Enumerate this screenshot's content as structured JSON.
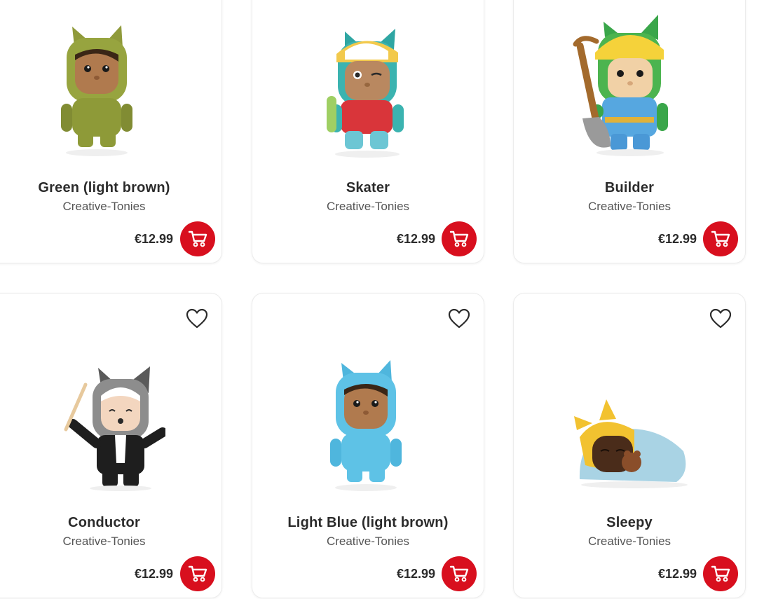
{
  "products": [
    {
      "name": "Green (light brown)",
      "brand": "Creative-Tonies",
      "price": "€12.99",
      "icon": "green-tonie-figure"
    },
    {
      "name": "Skater",
      "brand": "Creative-Tonies",
      "price": "€12.99",
      "icon": "skater-tonie-figure"
    },
    {
      "name": "Builder",
      "brand": "Creative-Tonies",
      "price": "€12.99",
      "icon": "builder-tonie-figure"
    },
    {
      "name": "Conductor",
      "brand": "Creative-Tonies",
      "price": "€12.99",
      "icon": "conductor-tonie-figure"
    },
    {
      "name": "Light Blue (light brown)",
      "brand": "Creative-Tonies",
      "price": "€12.99",
      "icon": "light-blue-tonie-figure"
    },
    {
      "name": "Sleepy",
      "brand": "Creative-Tonies",
      "price": "€12.99",
      "icon": "sleepy-tonie-figure"
    }
  ],
  "colors": {
    "accent": "#d80f1e",
    "card_border": "#ececec",
    "text": "#2b2b2b"
  }
}
